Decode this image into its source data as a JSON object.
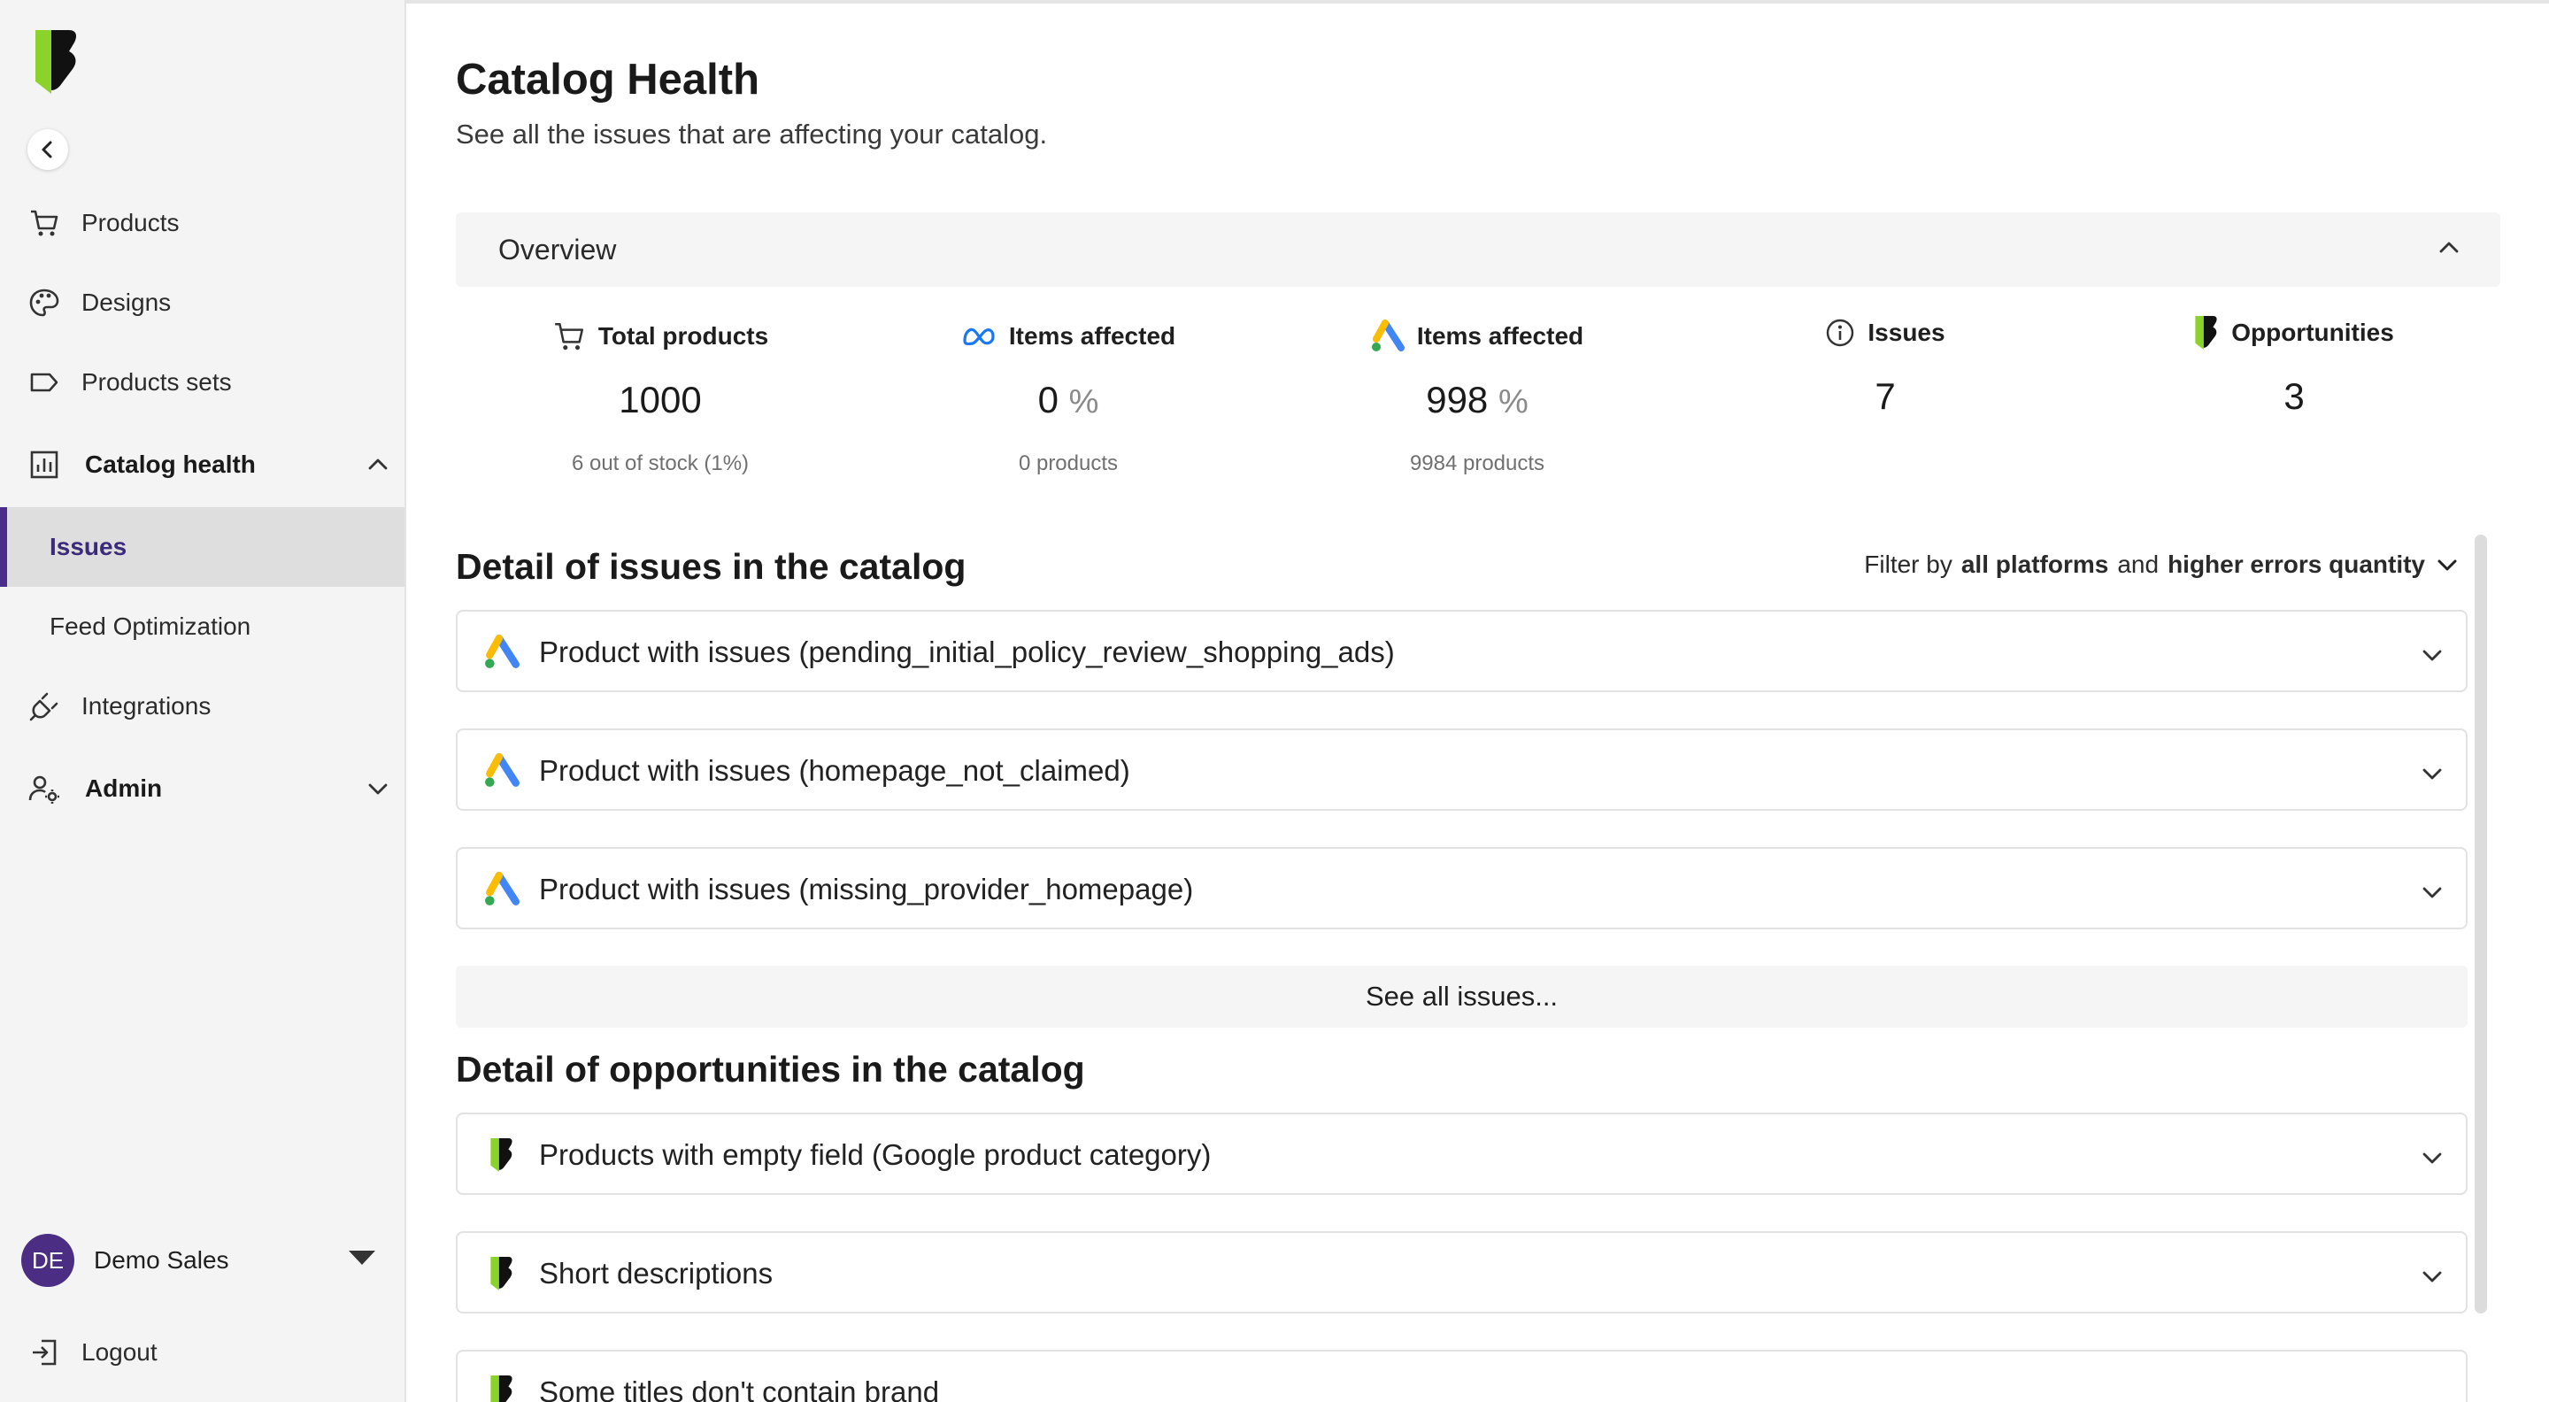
{
  "sidebar": {
    "nav": {
      "products": "Products",
      "designs": "Designs",
      "product_sets": "Products sets",
      "catalog_health": "Catalog health",
      "issues": "Issues",
      "feed_optimization": "Feed Optimization",
      "integrations": "Integrations",
      "admin": "Admin"
    },
    "user": {
      "initials": "DE",
      "name": "Demo Sales"
    },
    "logout": "Logout"
  },
  "header": {
    "title": "Catalog Health",
    "subtitle": "See all the issues that are affecting your catalog."
  },
  "overview": {
    "label": "Overview",
    "stats": {
      "total_products": {
        "title": "Total products",
        "value": "1000",
        "sub": "6 out of stock (1%)",
        "icon": "cart-icon"
      },
      "meta_affected": {
        "title": "Items affected",
        "value": "0",
        "unit": "%",
        "sub": "0 products",
        "icon": "meta-icon"
      },
      "google_affected": {
        "title": "Items affected",
        "value": "998",
        "unit": "%",
        "sub": "9984 products",
        "icon": "google-ads-icon"
      },
      "issues": {
        "title": "Issues",
        "value": "7",
        "icon": "info-icon"
      },
      "opportunities": {
        "title": "Opportunities",
        "value": "3",
        "icon": "brand-icon"
      }
    }
  },
  "issues_section": {
    "title": "Detail of issues in the catalog",
    "filter": {
      "prefix": "Filter by",
      "platforms": "all platforms",
      "and": "and",
      "order": "higher errors quantity"
    },
    "items": [
      "Product with issues (pending_initial_policy_review_shopping_ads)",
      "Product with issues (homepage_not_claimed)",
      "Product with issues (missing_provider_homepage)"
    ],
    "see_all": "See all issues..."
  },
  "opportunities_section": {
    "title": "Detail of opportunities in the catalog",
    "items": [
      "Products with empty field (Google product category)",
      "Short descriptions",
      "Some titles don't contain brand"
    ]
  },
  "colors": {
    "brand_green": "#8bd22a",
    "active_purple": "#4a2d8a",
    "avatar_purple": "#4b2d83"
  }
}
